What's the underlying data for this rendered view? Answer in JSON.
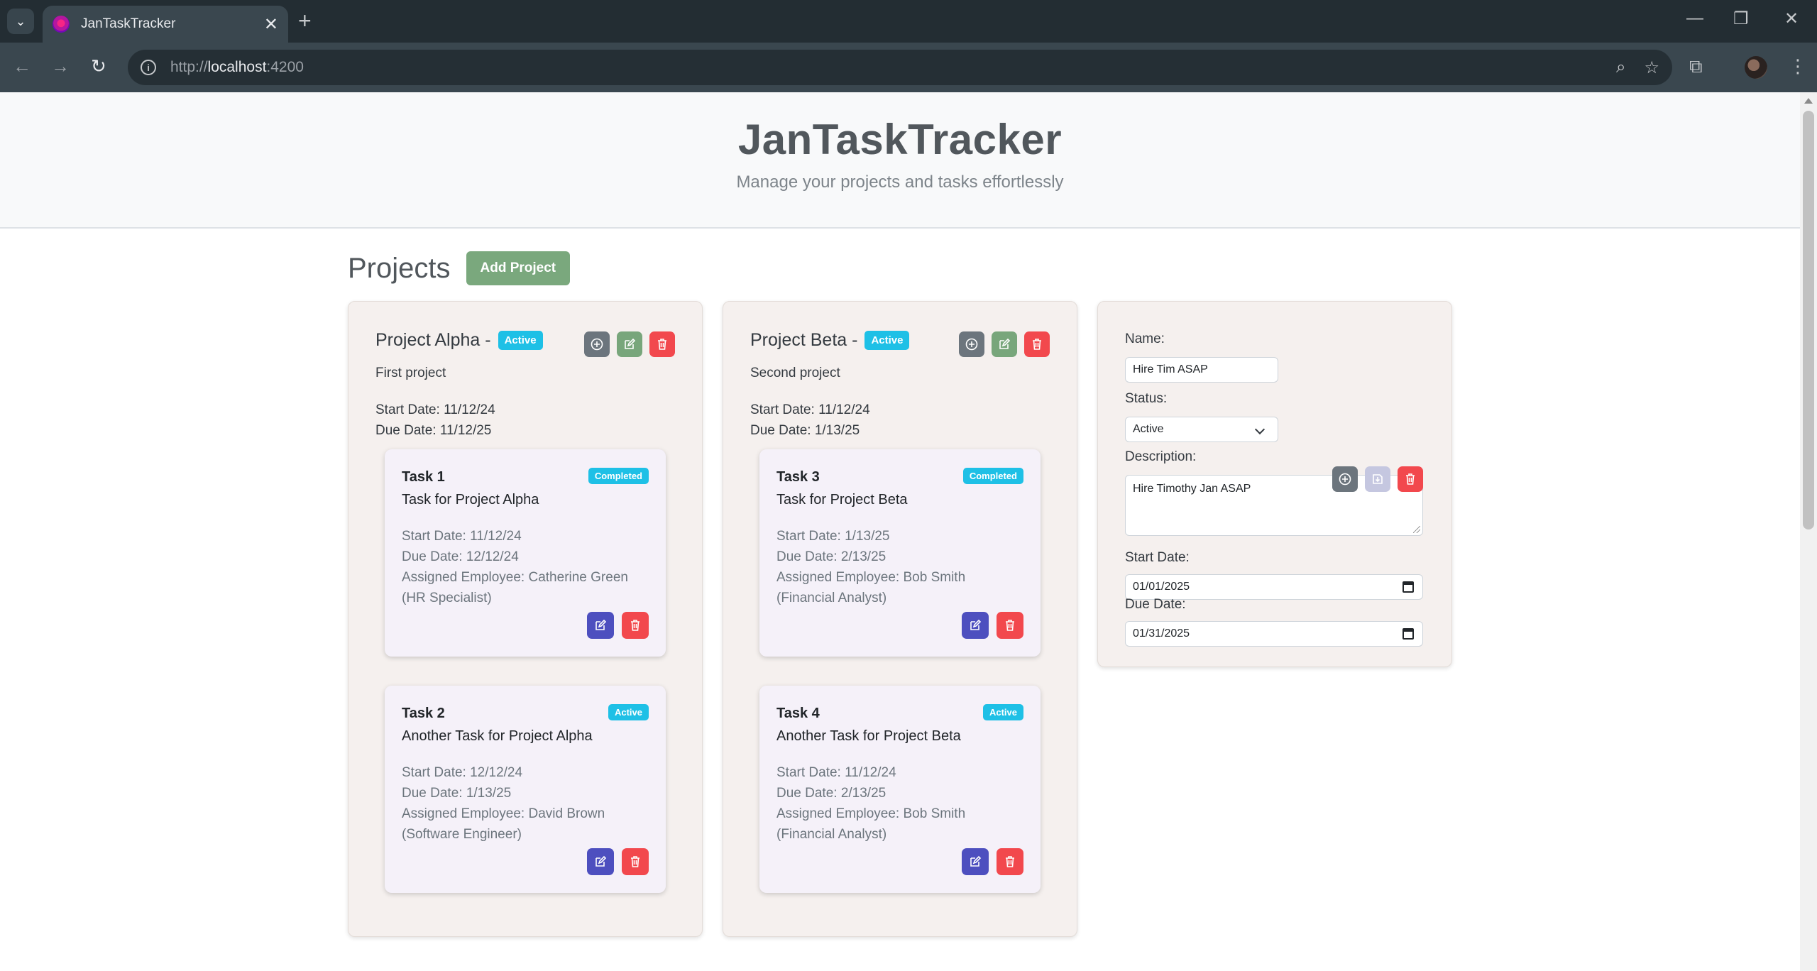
{
  "browser": {
    "tab_title": "JanTaskTracker",
    "url_prefix": "http://",
    "url_host": "localhost",
    "url_suffix": ":4200"
  },
  "hero": {
    "title": "JanTaskTracker",
    "subtitle": "Manage your projects and tasks effortlessly"
  },
  "projects_section": {
    "title": "Projects",
    "add_button": "Add Project"
  },
  "projects": [
    {
      "name": "Project Alpha -",
      "status": "Active",
      "description": "First project",
      "start_date": "Start Date: 11/12/24",
      "due_date": "Due Date: 11/12/25",
      "tasks": [
        {
          "name": "Task 1",
          "status": "Completed",
          "description": "Task for Project Alpha",
          "start_date": "Start Date: 11/12/24",
          "due_date": "Due Date: 12/12/24",
          "employee": "Assigned Employee: Catherine Green (HR Specialist)"
        },
        {
          "name": "Task 2",
          "status": "Active",
          "description": "Another Task for Project Alpha",
          "start_date": "Start Date: 12/12/24",
          "due_date": "Due Date: 1/13/25",
          "employee": "Assigned Employee: David Brown (Software Engineer)"
        }
      ]
    },
    {
      "name": "Project Beta -",
      "status": "Active",
      "description": "Second project",
      "start_date": "Start Date: 11/12/24",
      "due_date": "Due Date: 1/13/25",
      "tasks": [
        {
          "name": "Task 3",
          "status": "Completed",
          "description": "Task for Project Beta",
          "start_date": "Start Date: 1/13/25",
          "due_date": "Due Date: 2/13/25",
          "employee": "Assigned Employee: Bob Smith (Financial Analyst)"
        },
        {
          "name": "Task 4",
          "status": "Active",
          "description": "Another Task for Project Beta",
          "start_date": "Start Date: 11/12/24",
          "due_date": "Due Date: 2/13/25",
          "employee": "Assigned Employee: Bob Smith (Financial Analyst)"
        }
      ]
    }
  ],
  "new_project_form": {
    "name_label": "Name:",
    "name_value": "Hire Tim ASAP",
    "status_label": "Status:",
    "status_value": "Active",
    "description_label": "Description:",
    "description_value": "Hire Timothy Jan ASAP",
    "start_date_label": "Start Date:",
    "start_date_value": "01/01/2025",
    "due_date_label": "Due Date:",
    "due_date_value": "01/31/2025"
  },
  "colors": {
    "badge": "#1ec0e6",
    "add_button": "#7aa87d",
    "delete": "#f2484d",
    "edit_task": "#4d4fbf",
    "edit_project": "#78a67b",
    "add_task": "#6c757d"
  },
  "icons": [
    "plus-circle-icon",
    "edit-icon",
    "trash-icon",
    "save-icon",
    "calendar-icon",
    "chevron-down-icon"
  ]
}
